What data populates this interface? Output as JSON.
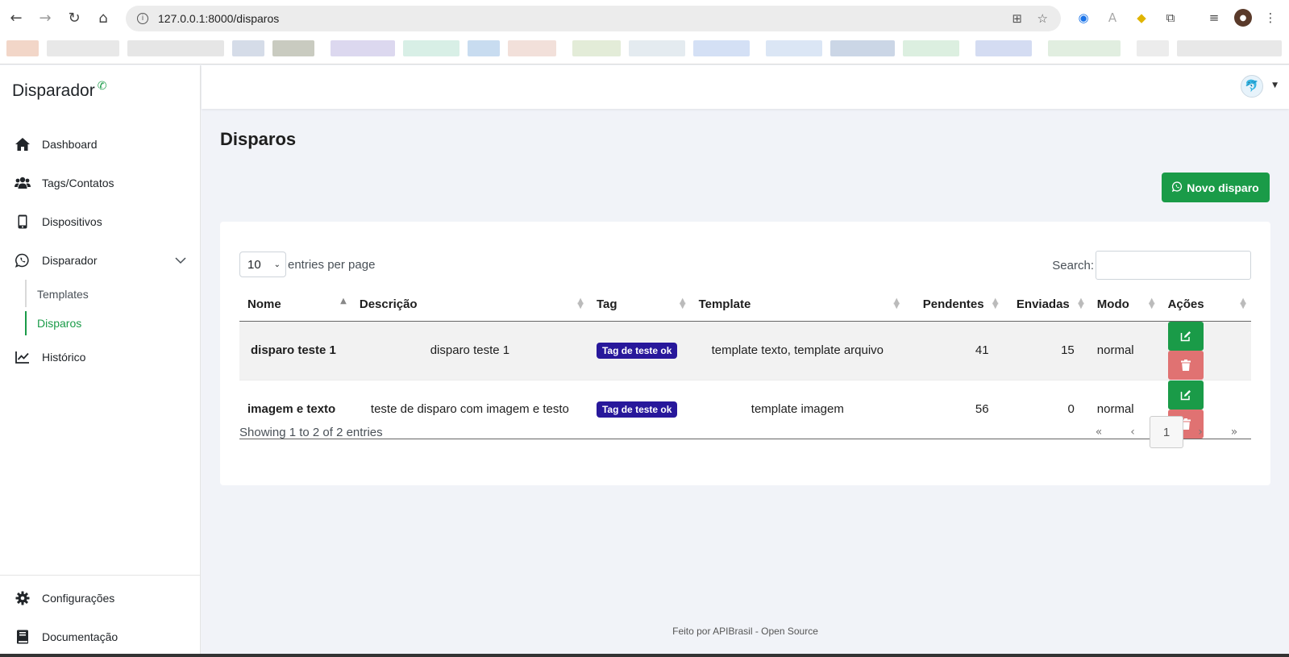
{
  "browser": {
    "url": "127.0.0.1:8000/disparos",
    "back_icon": "arrow-left-icon",
    "forward_icon": "arrow-right-icon",
    "reload_icon": "reload-icon",
    "home_icon": "home-icon"
  },
  "sidebar": {
    "brand": "Disparador",
    "brand_icon": "whatsapp-icon",
    "items": [
      {
        "label": "Dashboard",
        "icon": "home-icon"
      },
      {
        "label": "Tags/Contatos",
        "icon": "users-icon"
      },
      {
        "label": "Dispositivos",
        "icon": "mobile-icon"
      },
      {
        "label": "Disparador",
        "icon": "whatsapp-icon"
      },
      {
        "label": "Histórico",
        "icon": "chart-line-icon"
      }
    ],
    "subitems": [
      {
        "label": "Templates",
        "active": false
      },
      {
        "label": "Disparos",
        "active": true
      }
    ],
    "bottom_items": [
      {
        "label": "Configurações",
        "icon": "gear-icon"
      },
      {
        "label": "Documentação",
        "icon": "book-icon"
      }
    ]
  },
  "main": {
    "title": "Disparos",
    "new_button": "Novo disparo",
    "per_page_value": "10",
    "per_page_label": "entries per page",
    "search_label": "Search:",
    "search_value": "",
    "columns": [
      "Nome",
      "Descrição",
      "Tag",
      "Template",
      "Pendentes",
      "Enviadas",
      "Modo",
      "Ações"
    ],
    "rows": [
      {
        "nome": "disparo teste 1",
        "descricao": "disparo teste 1",
        "tag": "Tag de teste ok",
        "template": "template texto, template arquivo",
        "pendentes": "41",
        "enviadas": "15",
        "modo": "normal"
      },
      {
        "nome": "imagem e texto",
        "descricao": "teste de disparo com imagem e testo",
        "tag": "Tag de teste ok",
        "template": "template imagem",
        "pendentes": "56",
        "enviadas": "0",
        "modo": "normal"
      }
    ],
    "showing": "Showing 1 to 2 of 2 entries",
    "pager": {
      "first": "«",
      "prev": "‹",
      "current": "1",
      "next": "›",
      "last": "»"
    }
  },
  "footer": "Feito por APIBrasil - Open Source",
  "colors": {
    "primary": "#1a9b48",
    "badge": "#28189b",
    "danger": "#e07272"
  }
}
